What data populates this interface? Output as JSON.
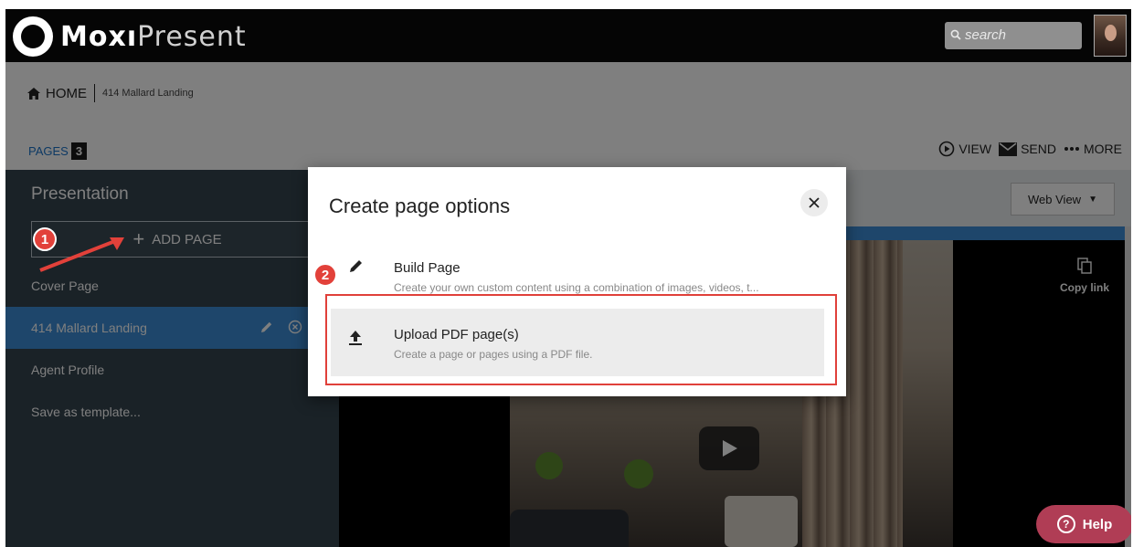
{
  "app": {
    "logo_bold": "Moxı",
    "logo_light": "Present"
  },
  "search": {
    "placeholder": "search"
  },
  "breadcrumb": {
    "home": "HOME",
    "address": "414 Mallard Landing"
  },
  "pages": {
    "label": "PAGES",
    "count": "3"
  },
  "actions": {
    "view": "VIEW",
    "send": "SEND",
    "more": "MORE"
  },
  "sidebar": {
    "title": "Presentation",
    "add_page": "ADD PAGE",
    "items": [
      {
        "label": "Cover Page"
      },
      {
        "label": "414 Mallard Landing"
      },
      {
        "label": "Agent Profile"
      },
      {
        "label": "Save as template..."
      }
    ]
  },
  "content": {
    "view_mode": "Web View",
    "copy_link": "Copy link"
  },
  "modal": {
    "title": "Create page options",
    "options": [
      {
        "label": "Build Page",
        "description": "Create your own custom content using a combination of images, videos, t..."
      },
      {
        "label": "Upload PDF page(s)",
        "description": "Create a page or pages using a PDF file."
      }
    ]
  },
  "annotations": {
    "step1": "1",
    "step2": "2"
  },
  "help": {
    "label": "Help",
    "glyph": "?"
  },
  "colors": {
    "accent_blue": "#3c8dd6",
    "sidebar_bg": "#35444f",
    "annotation_red": "#e2413a",
    "help_bg": "#b03d55"
  },
  "icons": [
    "search-icon",
    "home-icon",
    "play-circle-icon",
    "envelope-icon",
    "more-dots-icon",
    "pencil-icon",
    "remove-circle-icon",
    "copy-icon",
    "close-icon",
    "upload-icon",
    "help-icon"
  ]
}
